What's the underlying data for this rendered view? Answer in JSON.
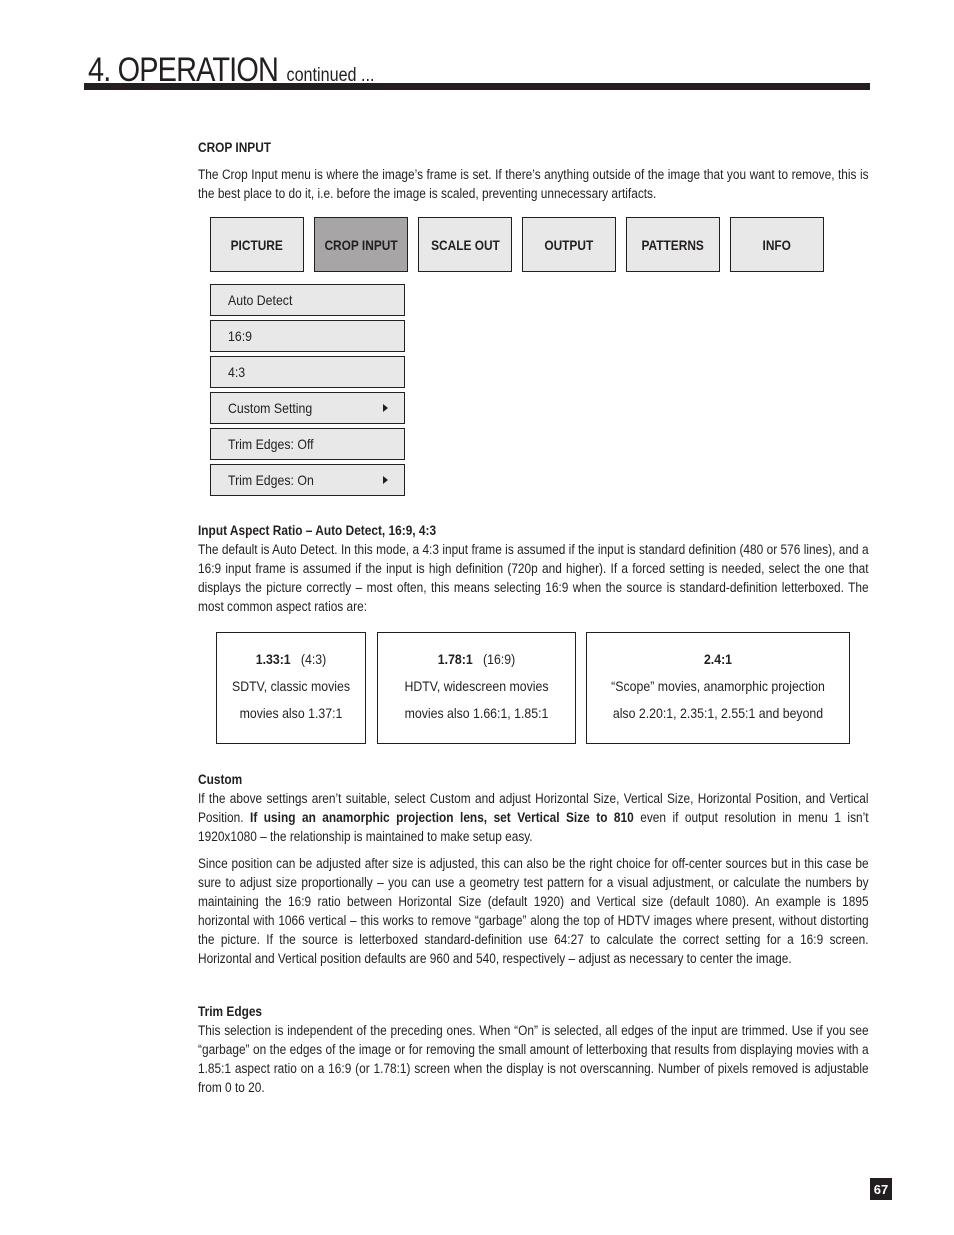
{
  "header": {
    "title": "4. OPERATION",
    "continued": "continued ..."
  },
  "crop_input": {
    "heading": "CROP INPUT",
    "intro": "The Crop Input menu is where the image’s frame is set. If there’s anything outside of the image that you want to remove, this is the best place to do it, i.e. before the image is scaled, preventing unnecessary artifacts."
  },
  "menu_tabs": [
    {
      "label": "PICTURE",
      "active": false
    },
    {
      "label": "CROP INPUT",
      "active": true
    },
    {
      "label": "SCALE OUT",
      "active": false
    },
    {
      "label": "OUTPUT",
      "active": false
    },
    {
      "label": "PATTERNS",
      "active": false
    },
    {
      "label": "INFO",
      "active": false
    }
  ],
  "submenu_items": [
    {
      "label": "Auto Detect",
      "has_submenu": false
    },
    {
      "label": "16:9",
      "has_submenu": false
    },
    {
      "label": "4:3",
      "has_submenu": false
    },
    {
      "label": "Custom Setting",
      "has_submenu": true
    },
    {
      "label": "Trim Edges: Off",
      "has_submenu": false
    },
    {
      "label": "Trim Edges: On",
      "has_submenu": true
    }
  ],
  "aspect_section": {
    "heading": "Input Aspect Ratio – Auto Detect, 16:9, 4:3",
    "body": "The default is Auto Detect. In this mode, a 4:3 input frame is assumed if the input is standard definition (480 or 576 lines), and a 16:9 input frame is assumed if the input is high definition (720p and higher). If a forced setting is needed, select the one that displays the picture correctly – most often, this means selecting 16:9 when the source is standard-definition letterboxed. The most common aspect ratios are:"
  },
  "ratios": [
    {
      "ratio": "1.33:1",
      "alt": "(4:3)",
      "use": "SDTV, classic movies",
      "also": "movies also 1.37:1"
    },
    {
      "ratio": "1.78:1",
      "alt": "(16:9)",
      "use": "HDTV, widescreen movies",
      "also": "movies also 1.66:1, 1.85:1"
    },
    {
      "ratio": "2.4:1",
      "alt": "",
      "use": "“Scope” movies, anamorphic projection",
      "also": "also 2.20:1, 2.35:1, 2.55:1 and beyond"
    }
  ],
  "custom_section": {
    "heading": "Custom",
    "p1_start": "If the above settings aren’t suitable, select Custom and adjust Horizontal Size, Vertical Size, Horizontal Position, and Vertical Position. ",
    "p1_bold": "If using an anamorphic projection lens, set Vertical Size to 810",
    "p1_end": " even if output resolution in menu 1 isn’t 1920x1080 – the relationship is maintained to make setup easy.",
    "p2": "Since position can be adjusted after size is adjusted, this can also be the right choice for off-center sources but in this case be sure to adjust size proportionally – you can use a geometry test pattern for a visual adjustment, or calculate the numbers by maintaining the 16:9 ratio between Horizontal Size (default 1920) and Vertical size (default 1080). An example is 1895 horizontal with 1066 vertical – this works to remove “garbage” along the top of HDTV images where present, without distorting the picture. If the source is letterboxed standard-definition use 64:27 to calculate the correct setting for a 16:9 screen. Horizontal and Vertical position defaults are 960 and 540, respectively – adjust as necessary to center the image."
  },
  "trim_section": {
    "heading": "Trim Edges",
    "body": "This selection is independent of the preceding ones. When “On” is selected, all edges of the input are trimmed. Use if you see “garbage” on the edges of the image or for removing the small amount of letterboxing that results from displaying movies with a 1.85:1 aspect ratio on a 16:9 (or 1.78:1) screen when the display is not overscanning. Number of pixels removed is adjustable from 0 to 20."
  },
  "page_number": "67"
}
